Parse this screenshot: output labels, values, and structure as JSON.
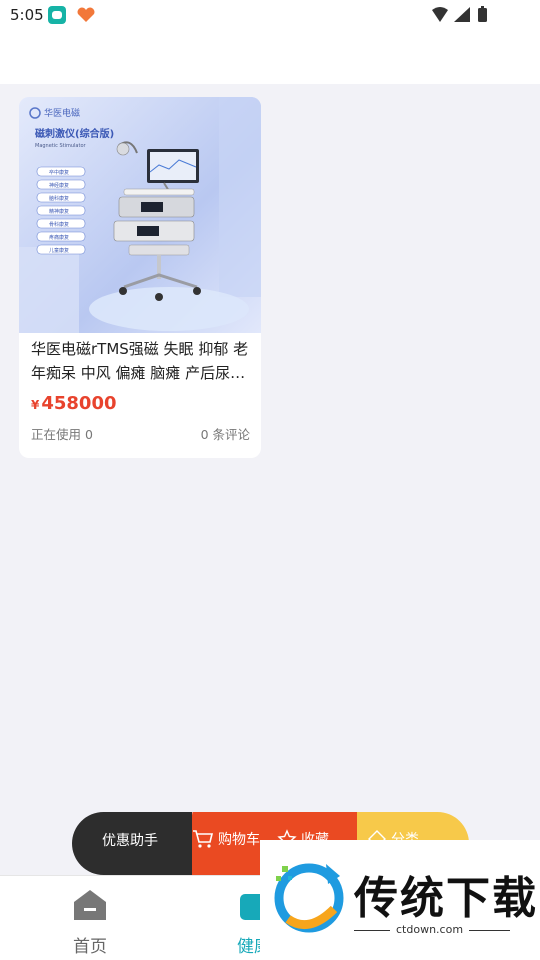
{
  "status_bar": {
    "time": "5:05"
  },
  "product": {
    "image_text": {
      "brand": "华医电磁",
      "headline": "磁刺激仪(综合版)",
      "subheadline": "Magnetic Stimulator",
      "features": [
        "卒中康复",
        "神经康复",
        "脑科康复",
        "精神康复",
        "骨科康复",
        "疼痛康复",
        "儿童康复"
      ]
    },
    "title": "华医电磁rTMS强磁 失眠 抑郁 老年痴呆 中风 偏瘫 脑瘫 产后尿…",
    "currency": "¥",
    "price": "458000",
    "in_use": "正在使用 0",
    "reviews": "0 条评论"
  },
  "float_bar": {
    "assistant": "优惠助手",
    "cart": "购物车",
    "favorite": "收藏",
    "category": "分类"
  },
  "bottom_nav": {
    "home": "首页",
    "health": "健康"
  },
  "watermark": {
    "brand": "传统下载",
    "domain": "ctdown.com"
  },
  "colors": {
    "accent_teal": "#17a9b9",
    "price_red": "#e8432d",
    "cart_red": "#ea4a22",
    "category_yellow": "#f7c94a",
    "assistant_dark": "#2d2d2d"
  }
}
